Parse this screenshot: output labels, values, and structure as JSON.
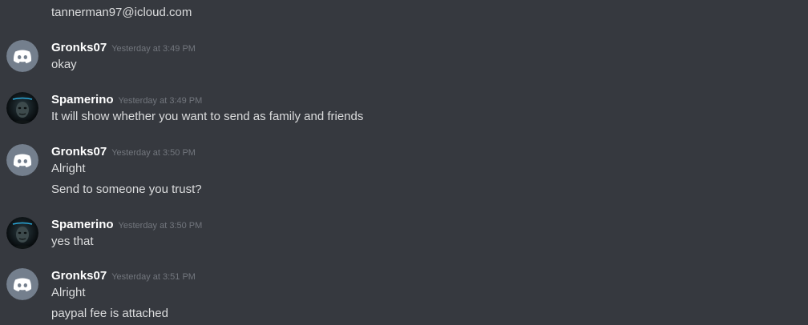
{
  "top_line": "tannerman97@icloud.com",
  "messages": [
    {
      "author": "Gronks07",
      "avatar": "discord-default-avatar",
      "timestamp": "Yesterday at 3:49 PM",
      "lines": [
        "okay"
      ]
    },
    {
      "author": "Spamerino",
      "avatar": "dark-masked-face-avatar",
      "timestamp": "Yesterday at 3:49 PM",
      "lines": [
        "It will show whether you want to send as family and friends"
      ]
    },
    {
      "author": "Gronks07",
      "avatar": "discord-default-avatar",
      "timestamp": "Yesterday at 3:50 PM",
      "lines": [
        "Alright",
        "Send to someone you trust?"
      ]
    },
    {
      "author": "Spamerino",
      "avatar": "dark-masked-face-avatar",
      "timestamp": "Yesterday at 3:50 PM",
      "lines": [
        "yes that"
      ]
    },
    {
      "author": "Gronks07",
      "avatar": "discord-default-avatar",
      "timestamp": "Yesterday at 3:51 PM",
      "lines": [
        "Alright",
        "paypal fee is attached"
      ]
    }
  ],
  "colors": {
    "background": "#36393f",
    "username": "#ffffff",
    "message_text": "#dcddde",
    "timestamp": "#72767d",
    "default_avatar_bg": "#747f8d"
  }
}
